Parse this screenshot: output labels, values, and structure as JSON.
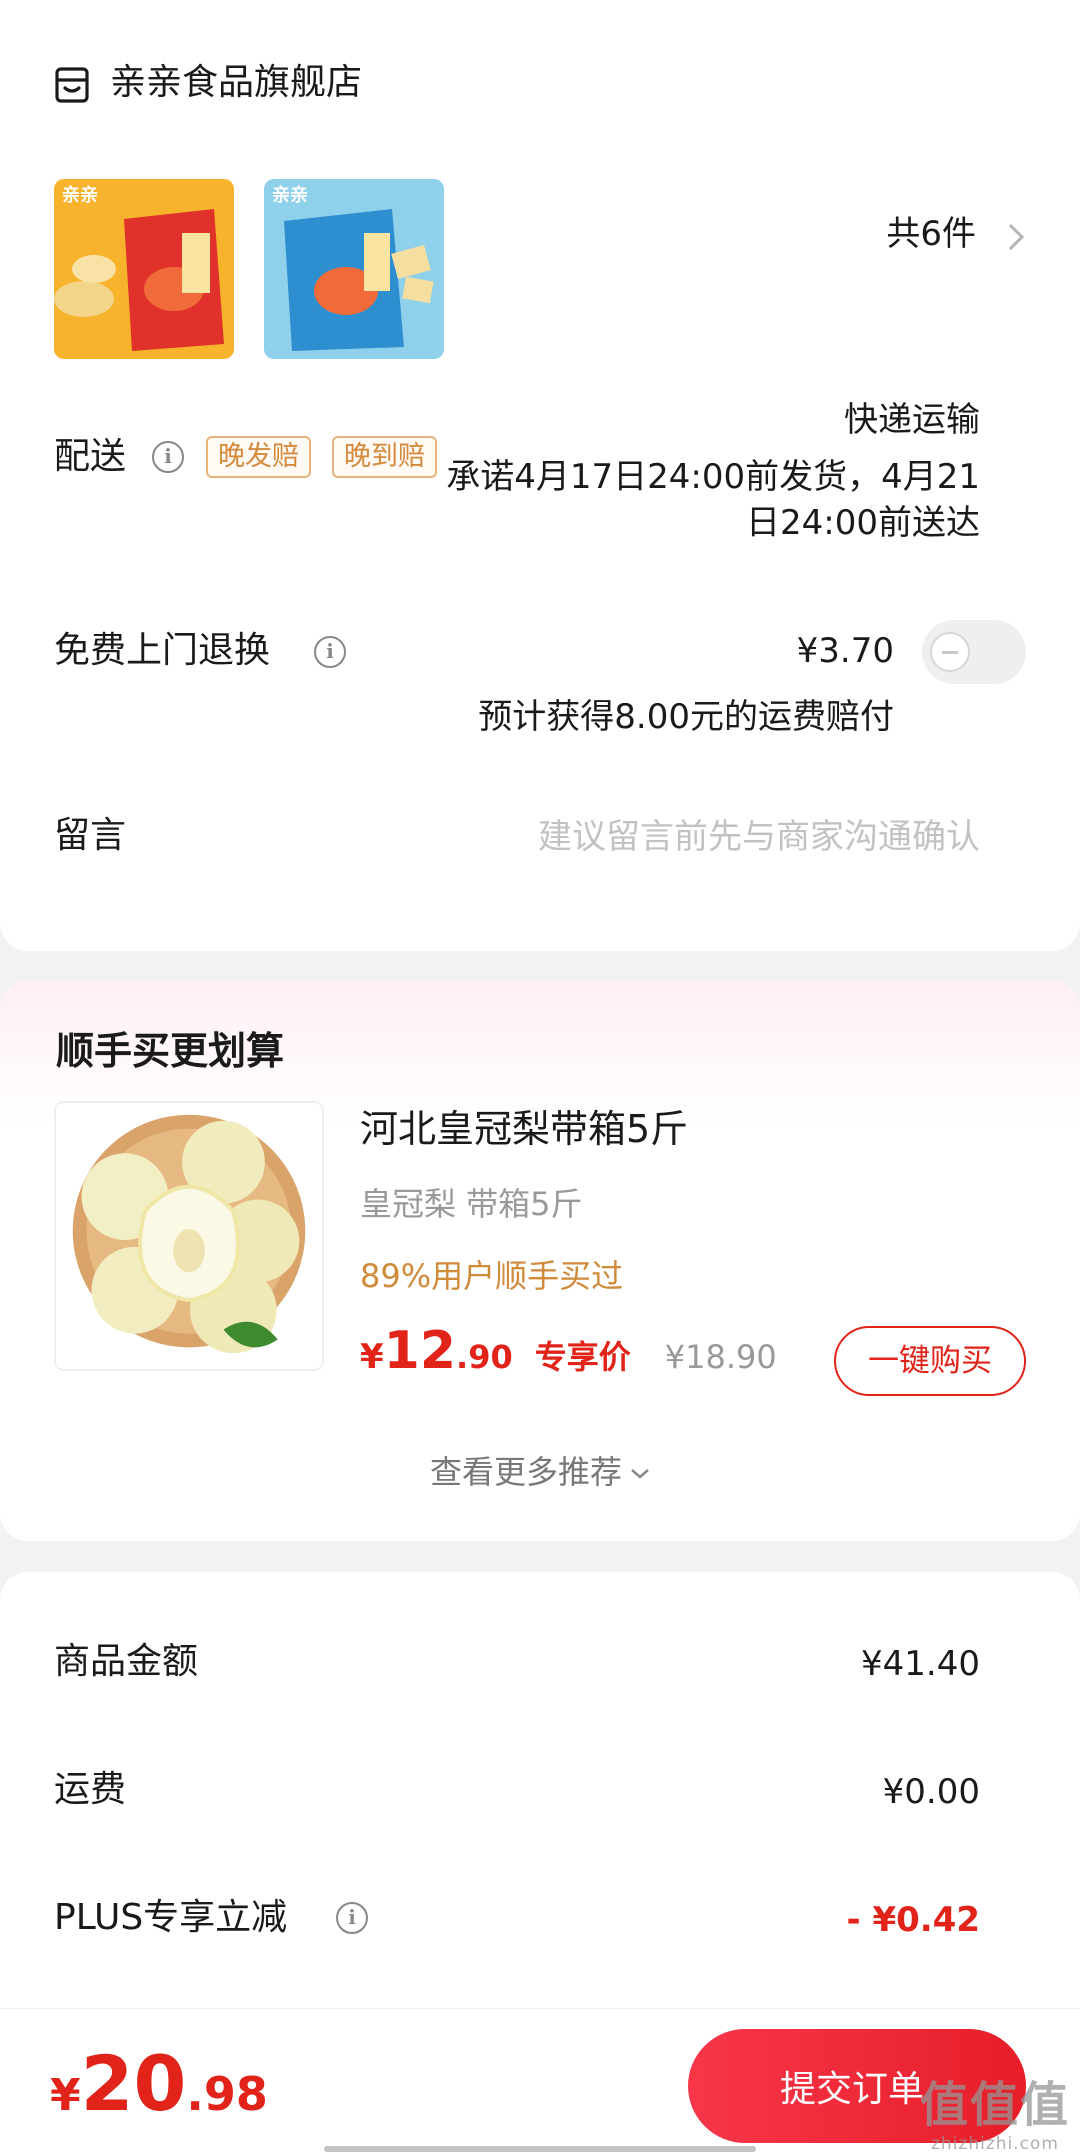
{
  "store": {
    "name": "亲亲食品旗舰店",
    "icon": "store-icon",
    "item_count": "共6件",
    "products": [
      {
        "name": "product-thumb-orange-bag",
        "bg": "#f7b32c",
        "bag": "#e0322a"
      },
      {
        "name": "product-thumb-blue-bag",
        "bg": "#7fc7e4",
        "bag": "#2e8fd0"
      }
    ]
  },
  "delivery": {
    "label": "配送",
    "tags": [
      "晚发赔",
      "晚到赔"
    ],
    "method": "快递运输",
    "promise": "承诺4月17日24:00前发货，4月21日24:00前送达"
  },
  "return_service": {
    "label": "免费上门退换",
    "price": "¥3.70",
    "enabled": false,
    "note": "预计获得8.00元的运费赔付"
  },
  "message": {
    "label": "留言",
    "placeholder": "建议留言前先与商家沟通确认"
  },
  "recommend": {
    "title": "顺手买更划算",
    "product": {
      "name": "河北皇冠梨带箱5斤",
      "spec": "皇冠梨 带箱5斤",
      "social": "89%用户顺手买过",
      "price_symbol": "¥",
      "price_int": "12",
      "price_dec": ".90",
      "price_tag": "专享价",
      "orig_price": "¥18.90",
      "buy_label": "一键购买"
    },
    "more_label": "查看更多推荐"
  },
  "summary": {
    "rows": [
      {
        "label": "商品金额",
        "value": "¥41.40"
      },
      {
        "label": "运费",
        "value": "¥0.00"
      },
      {
        "label": "PLUS专享立减",
        "value": "- ¥0.42"
      }
    ]
  },
  "bottom": {
    "total_symbol": "¥",
    "total_int": "20",
    "total_dec": ".98",
    "submit_label": "提交订单",
    "watermark_main": "值值值",
    "watermark_sub": "zhizhizhi.com"
  },
  "colors": {
    "accent_red": "#e2231a",
    "tag_orange": "#d4893c"
  }
}
